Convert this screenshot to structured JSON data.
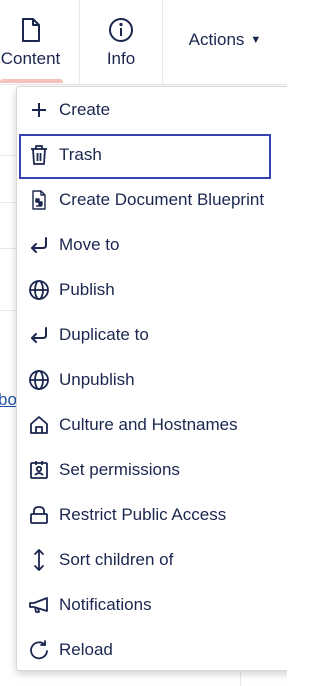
{
  "header": {
    "tabs": [
      {
        "label": "Content",
        "icon": "document-icon"
      },
      {
        "label": "Info",
        "icon": "info-circle-icon"
      }
    ],
    "actions": {
      "label": "Actions",
      "icon": "caret-down-icon"
    }
  },
  "background": {
    "link_text": "bo"
  },
  "menu": {
    "items": [
      {
        "label": "Create",
        "icon": "plus-icon"
      },
      {
        "label": "Trash",
        "icon": "trash-icon",
        "focused": true
      },
      {
        "label": "Create Document Blueprint",
        "icon": "blueprint-icon"
      },
      {
        "label": "Move to",
        "icon": "enter-arrow-icon"
      },
      {
        "label": "Publish",
        "icon": "globe-icon"
      },
      {
        "label": "Duplicate to",
        "icon": "enter-arrow-icon"
      },
      {
        "label": "Unpublish",
        "icon": "globe-icon"
      },
      {
        "label": "Culture and Hostnames",
        "icon": "home-icon"
      },
      {
        "label": "Set permissions",
        "icon": "badge-icon"
      },
      {
        "label": "Restrict Public Access",
        "icon": "lock-icon"
      },
      {
        "label": "Sort children of",
        "icon": "sort-arrows-icon"
      },
      {
        "label": "Notifications",
        "icon": "megaphone-icon"
      },
      {
        "label": "Reload",
        "icon": "reload-icon"
      }
    ]
  },
  "colors": {
    "text": "#1b264f",
    "focus_outline": "#3544b1",
    "link": "#2152a3",
    "active_tab_indicator": "#f5c1bc"
  }
}
